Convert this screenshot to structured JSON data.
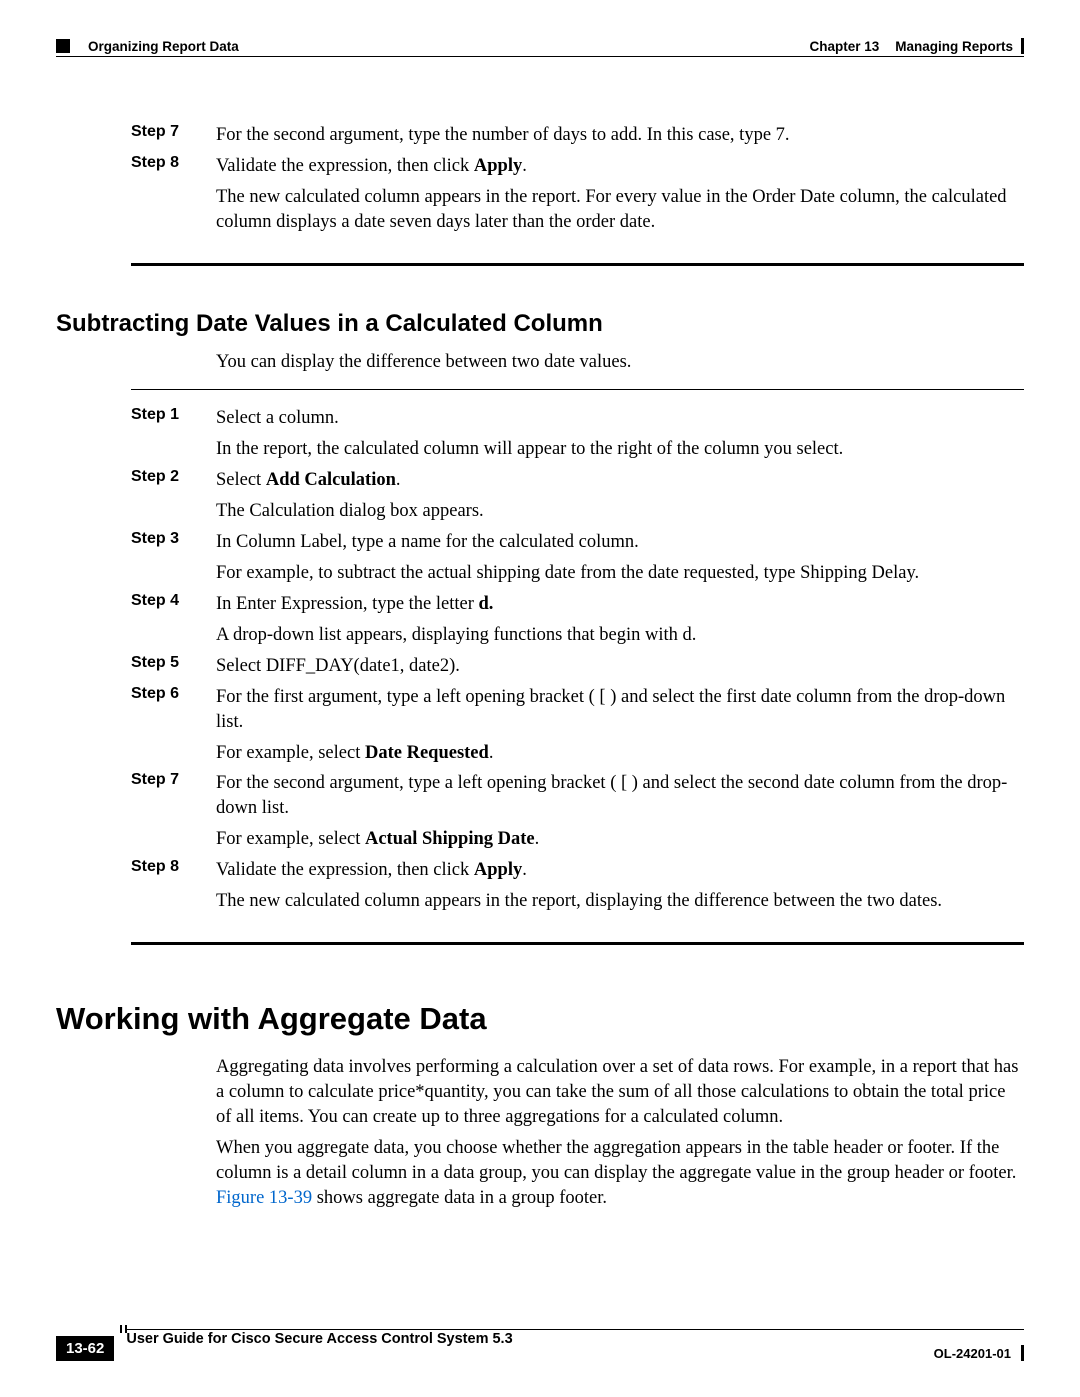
{
  "header": {
    "section": "Organizing Report Data",
    "chapter_label": "Chapter 13",
    "chapter_title": "Managing Reports"
  },
  "top_steps": {
    "s7": {
      "label": "Step 7",
      "text": "For the second argument, type the number of days to add. In this case, type 7."
    },
    "s8": {
      "label": "Step 8",
      "line1a": "Validate the expression, then click ",
      "line1b": "Apply",
      "line1c": ".",
      "line2": "The new calculated column appears in the report. For every value in the Order Date column, the calculated column displays a date seven days later than the order date."
    }
  },
  "subtract": {
    "heading": "Subtracting Date Values in a Calculated Column",
    "intro": "You can display the difference between two date values.",
    "s1": {
      "label": "Step 1",
      "l1": "Select a column.",
      "l2": "In the report, the calculated column will appear to the right of the column you select."
    },
    "s2": {
      "label": "Step 2",
      "l1a": "Select ",
      "l1b": "Add Calculation",
      "l1c": ".",
      "l2": "The Calculation dialog box appears."
    },
    "s3": {
      "label": "Step 3",
      "l1": "In Column Label, type a name for the calculated column.",
      "l2": "For example, to subtract the actual shipping date from the date requested, type Shipping Delay."
    },
    "s4": {
      "label": "Step 4",
      "l1a": "In Enter Expression, type the letter ",
      "l1b": "d.",
      "l2": "A drop-down list appears, displaying functions that begin with d."
    },
    "s5": {
      "label": "Step 5",
      "l1": "Select DIFF_DAY(date1, date2)."
    },
    "s6": {
      "label": "Step 6",
      "l1": "For the first argument, type a left opening bracket ( [ ) and select the first date column from the drop-down list.",
      "l2a": "For example, select ",
      "l2b": "Date Requested",
      "l2c": "."
    },
    "s7": {
      "label": "Step 7",
      "l1": "For the second argument, type a left opening bracket ( [ ) and select the second date column from the drop-down list.",
      "l2a": "For example, select ",
      "l2b": "Actual Shipping Date",
      "l2c": "."
    },
    "s8": {
      "label": "Step 8",
      "l1a": "Validate the expression, then click ",
      "l1b": "Apply",
      "l1c": ".",
      "l2": "The new calculated column appears in the report, displaying the difference between the two dates."
    }
  },
  "aggregate": {
    "heading": "Working with Aggregate Data",
    "p1": "Aggregating data involves performing a calculation over a set of data rows. For example, in a report that has a column to calculate price*quantity, you can take the sum of all those calculations to obtain the total price of all items. You can create up to three aggregations for a calculated column.",
    "p2a": "When you aggregate data, you choose whether the aggregation appears in the table header or footer. If the column is a detail column in a data group, you can display the aggregate value in the group header or footer. ",
    "p2_link": "Figure 13-39",
    "p2b": " shows aggregate data in a group footer."
  },
  "footer": {
    "page": "13-62",
    "title": "User Guide for Cisco Secure Access Control System 5.3",
    "docid": "OL-24201-01"
  }
}
